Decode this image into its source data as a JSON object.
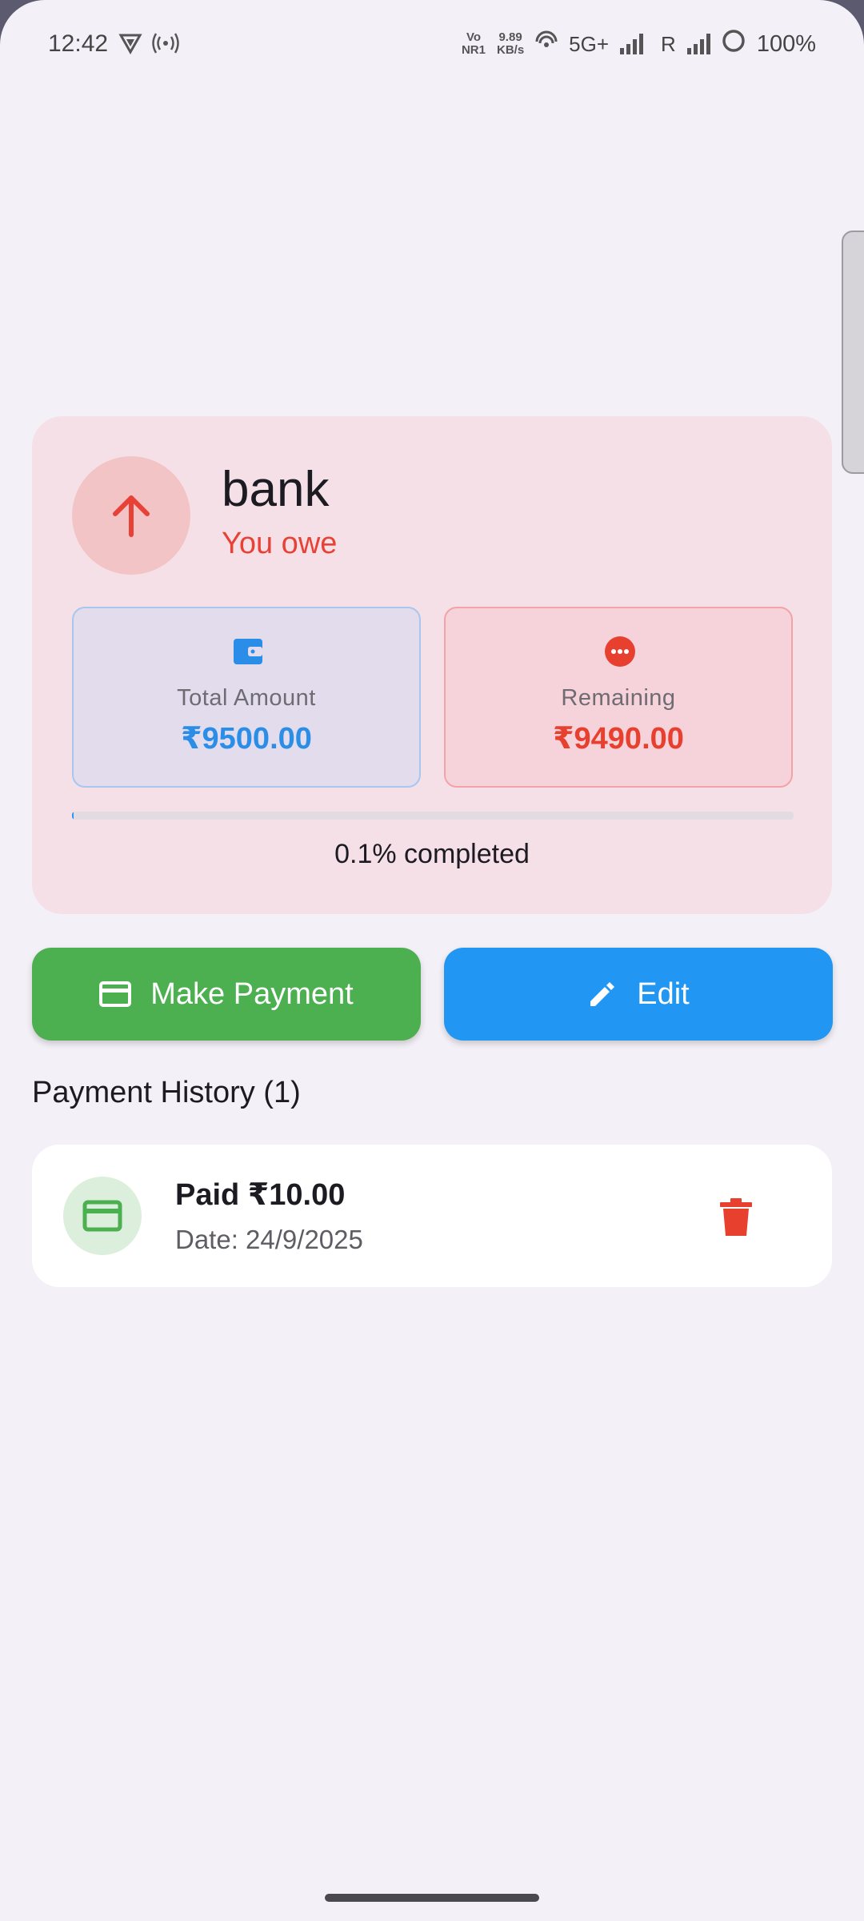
{
  "status_bar": {
    "time": "12:42",
    "net_top": "Vo",
    "net_bottom": "NR1",
    "speed_value": "9.89",
    "speed_unit": "KB/s",
    "network": "5G+",
    "roaming": "R",
    "battery": "100%"
  },
  "account": {
    "name": "bank",
    "direction": "You owe",
    "avatar_icon": "arrow-up-icon"
  },
  "stats": {
    "total_label": "Total Amount",
    "total_value": "₹9500.00",
    "total_icon": "wallet-icon",
    "remaining_label": "Remaining",
    "remaining_value": "₹9490.00",
    "remaining_icon": "more-horizontal-icon"
  },
  "progress": {
    "fraction": 0.001,
    "text": "0.1% completed"
  },
  "actions": {
    "pay_label": "Make Payment",
    "edit_label": "Edit"
  },
  "history": {
    "title": "Payment History (1)",
    "items": [
      {
        "title": "Paid ₹10.00",
        "date": "Date: 24/9/2025"
      }
    ]
  },
  "colors": {
    "owe_red": "#e74235",
    "accent_blue": "#2196f3",
    "pay_green": "#4caf50",
    "card_bg": "#f6e0e7",
    "page_bg": "#f4f0f7"
  }
}
